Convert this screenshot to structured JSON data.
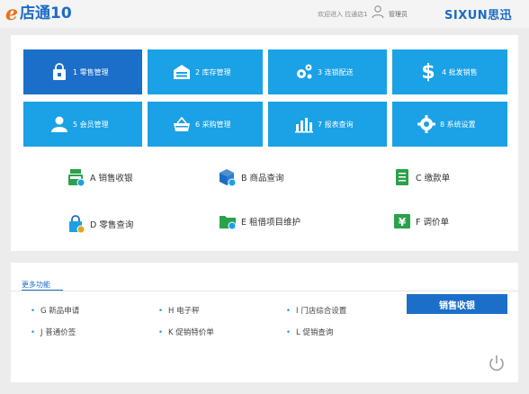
{
  "header": {
    "logo_e": "e",
    "logo_text": "店通10",
    "welcome": "欢迎进入 拉通店1",
    "username": "管理员",
    "brand": "SIXUN思迅"
  },
  "tiles": [
    {
      "label": "1 零售管理",
      "icon": "bag-icon"
    },
    {
      "label": "2 库存管理",
      "icon": "warehouse-icon"
    },
    {
      "label": "3 连锁配送",
      "icon": "gears-icon"
    },
    {
      "label": "4 批发销售",
      "icon": "dollar-icon"
    },
    {
      "label": "5 会员管理",
      "icon": "member-icon"
    },
    {
      "label": "6 采购管理",
      "icon": "basket-icon"
    },
    {
      "label": "7 报表查询",
      "icon": "bar-chart-icon"
    },
    {
      "label": "8 系统设置",
      "icon": "settings-gear-icon"
    }
  ],
  "functions": [
    {
      "label": "A 销售收银"
    },
    {
      "label": "B 商品查询"
    },
    {
      "label": "C 缴款单"
    },
    {
      "label": "D 零售查询"
    },
    {
      "label": "E 租借项目维护"
    },
    {
      "label": "F 调价单"
    }
  ],
  "more": {
    "title": "更多功能",
    "items": [
      "G 新品申请",
      "H 电子秤",
      "I 门店综合设置",
      "J 普通价签",
      "K 促销特价单",
      "L 促销查询"
    ],
    "cash_button": "销售收银"
  },
  "colors": {
    "tile": "#1aa1e6",
    "tile_active": "#1b6fc8",
    "brand": "#1b6cc4",
    "logo_e": "#e8731c"
  }
}
